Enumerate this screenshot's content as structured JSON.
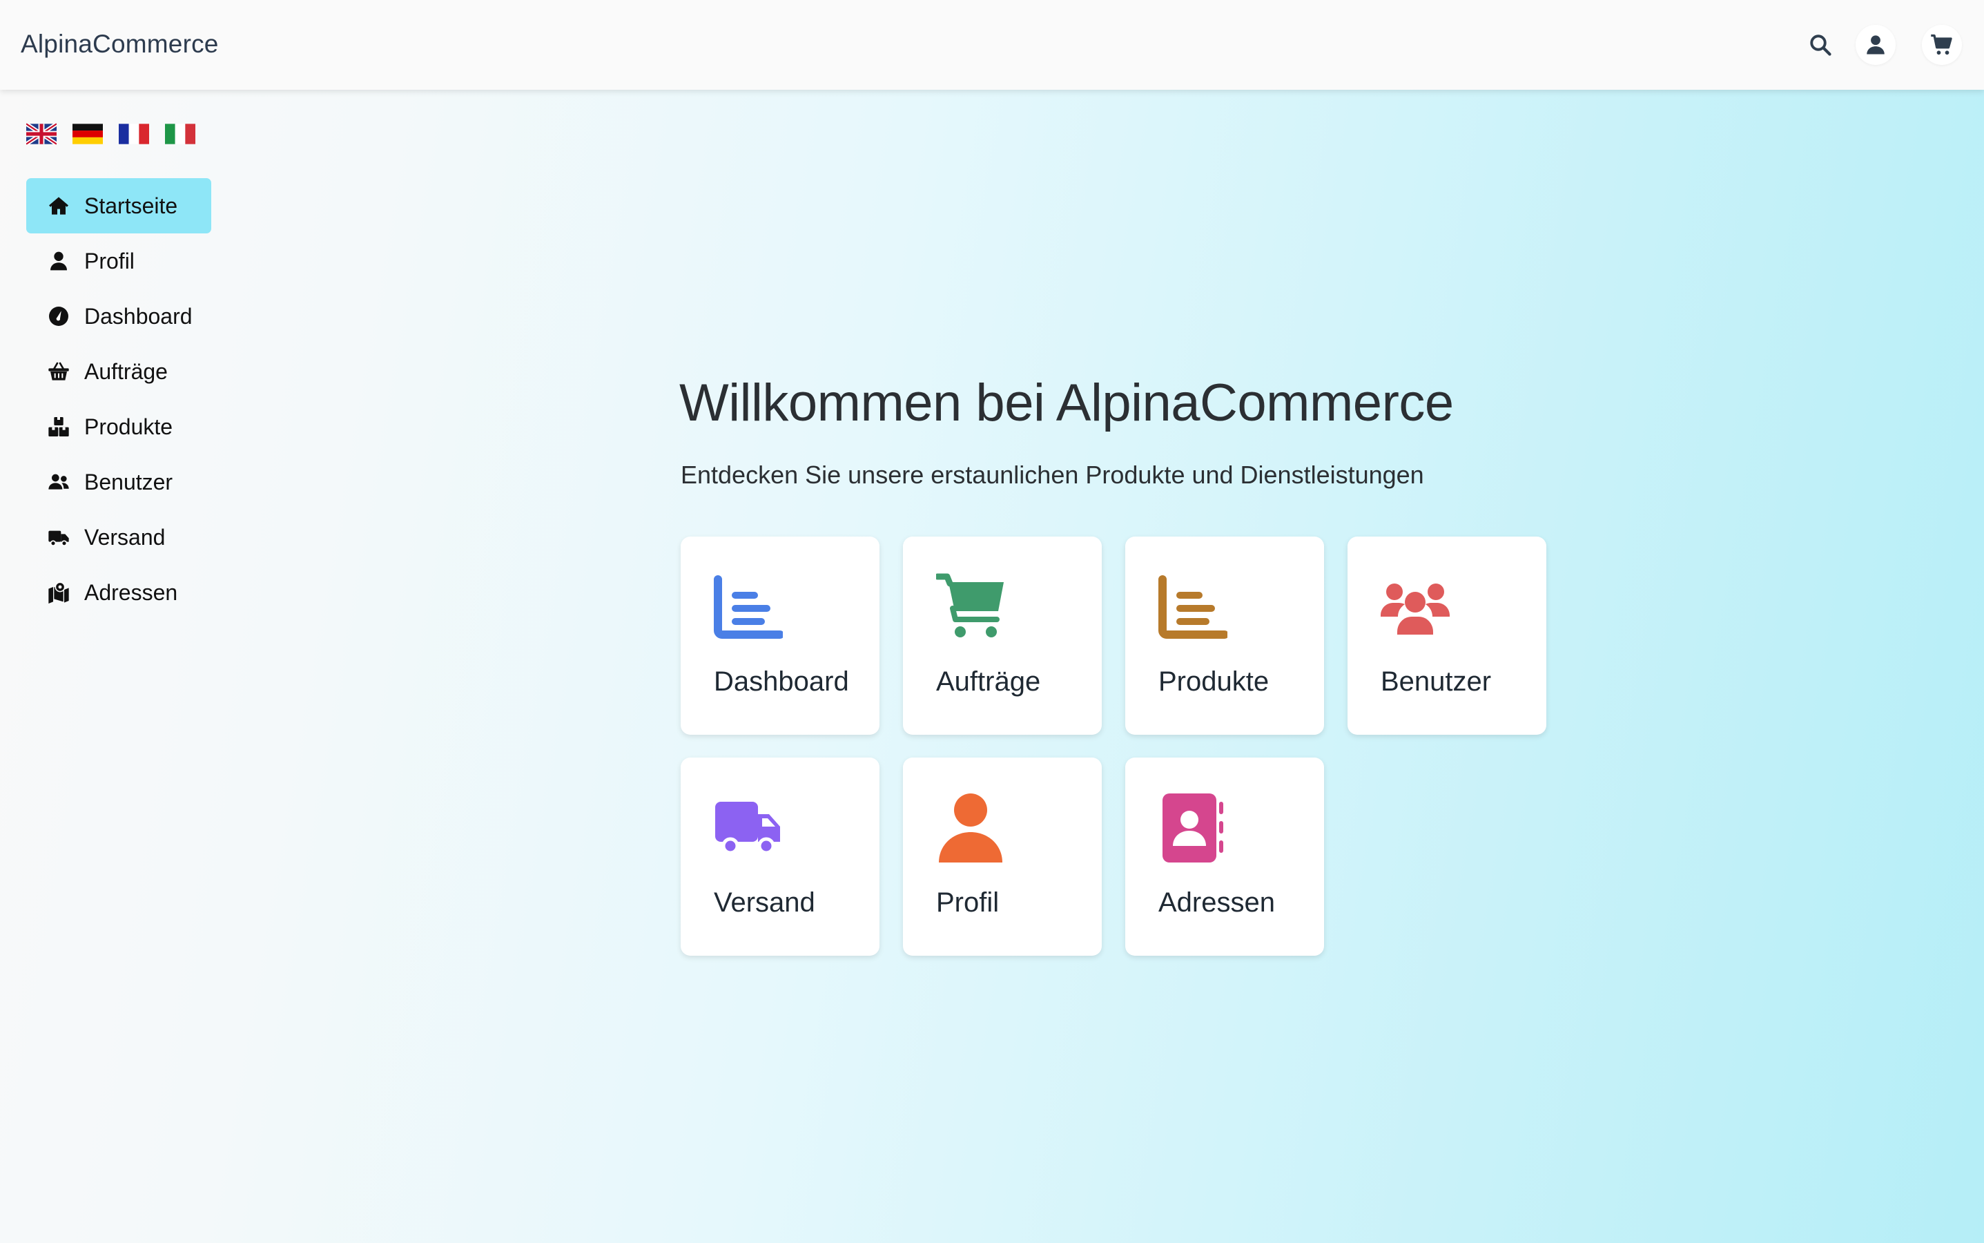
{
  "app": {
    "title": "AlpinaCommerce"
  },
  "topbar": {
    "icons": [
      "search-icon",
      "user-icon",
      "cart-icon"
    ]
  },
  "languages": [
    "english-flag",
    "german-flag",
    "french-flag",
    "italian-flag"
  ],
  "sidebar": {
    "items": [
      {
        "label": "Startseite",
        "icon": "home-icon",
        "active": true
      },
      {
        "label": "Profil",
        "icon": "user-icon"
      },
      {
        "label": "Dashboard",
        "icon": "gauge-icon"
      },
      {
        "label": "Aufträge",
        "icon": "basket-icon"
      },
      {
        "label": "Produkte",
        "icon": "boxes-icon"
      },
      {
        "label": "Benutzer",
        "icon": "users-icon"
      },
      {
        "label": "Versand",
        "icon": "truck-icon"
      },
      {
        "label": "Adressen",
        "icon": "map-icon"
      }
    ]
  },
  "hero": {
    "title": "Willkommen bei AlpinaCommerce",
    "subtitle": "Entdecken Sie unsere erstaunlichen Produkte und Dienstleistungen"
  },
  "cards": [
    {
      "label": "Dashboard",
      "icon": "chart-icon",
      "color": "#4a7fe6"
    },
    {
      "label": "Aufträge",
      "icon": "cart-icon",
      "color": "#3f9b6c"
    },
    {
      "label": "Produkte",
      "icon": "chart-icon",
      "color": "#b77a2b"
    },
    {
      "label": "Benutzer",
      "icon": "users-icon",
      "color": "#df5b5b"
    },
    {
      "label": "Versand",
      "icon": "truck-icon",
      "color": "#8c62f2"
    },
    {
      "label": "Profil",
      "icon": "user-icon",
      "color": "#ee6a34"
    },
    {
      "label": "Adressen",
      "icon": "address-book-icon",
      "color": "#d5468e"
    }
  ],
  "colors": {
    "nav_active": "#8ee6f7",
    "gradient_end": "#b5eef7"
  }
}
